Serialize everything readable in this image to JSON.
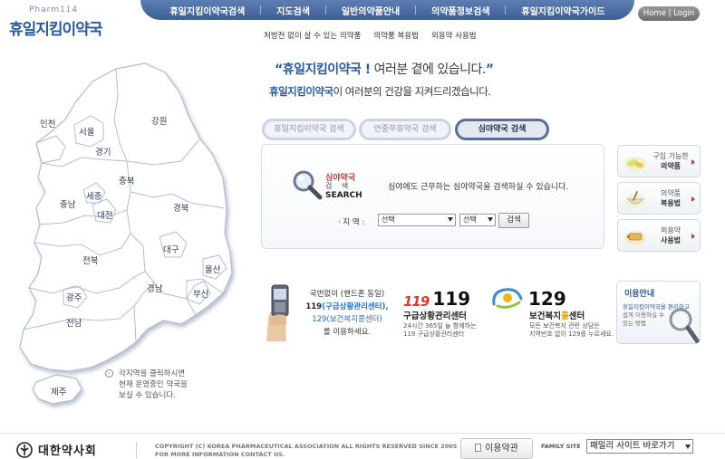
{
  "brand": {
    "sub": "Pharm114",
    "name": "휴일지킴이약국"
  },
  "topnav": {
    "items": [
      {
        "label": "휴일지킴이약국검색"
      },
      {
        "label": "지도검색"
      },
      {
        "label": "일반의약품안내"
      },
      {
        "label": "의약품정보검색"
      },
      {
        "label": "휴일지킴이약국가이드"
      }
    ]
  },
  "home_login": "Home | Login",
  "subnav": {
    "items": [
      {
        "label": "처방전 없이 살 수 있는 의약품"
      },
      {
        "label": "의약품 복용법"
      },
      {
        "label": "외용약 사용법"
      }
    ]
  },
  "slogan": {
    "open_quote": "“",
    "highlight": "휴일지킴이약국 !",
    "rest": " 여러분 곁에 있습니다.",
    "close_quote": "”",
    "line2_highlight": "휴일지킴이약국",
    "line2_rest": "이 여러분의 건강을 지켜드리겠습니다."
  },
  "tabs": [
    {
      "label": "휴일지킴이약국 검색",
      "active": false
    },
    {
      "label": "연중무휴약국 검색",
      "active": false
    },
    {
      "label": "심야약국 검색",
      "active": true
    }
  ],
  "search": {
    "title_ko": "심야약국",
    "title_ko2": "검 색",
    "title_en": "SEARCH",
    "description": "심야에도 근무하는 심야약국을 검색하실 수 있습니다.",
    "region_label": "· 지 역 :",
    "select1_value": "선택",
    "select2_value": "선택",
    "button": "검색"
  },
  "side_buttons": [
    {
      "line1": "구입 가능한",
      "line2": "의약품",
      "icon": "pills-icon"
    },
    {
      "line1": "의약품",
      "line2": "복용법",
      "icon": "mortar-icon"
    },
    {
      "line1": "외용약",
      "line2": "사용법",
      "icon": "ointment-icon"
    }
  ],
  "map": {
    "regions": [
      {
        "name": "인천"
      },
      {
        "name": "서울"
      },
      {
        "name": "경기"
      },
      {
        "name": "강원"
      },
      {
        "name": "충북"
      },
      {
        "name": "충남"
      },
      {
        "name": "세종"
      },
      {
        "name": "대전"
      },
      {
        "name": "경북"
      },
      {
        "name": "대구"
      },
      {
        "name": "전북"
      },
      {
        "name": "울산"
      },
      {
        "name": "경남"
      },
      {
        "name": "부산"
      },
      {
        "name": "광주"
      },
      {
        "name": "전남"
      },
      {
        "name": "제주"
      }
    ],
    "hint_lines": [
      "각지역을 클릭하시면",
      "현재 운영중인 약국을",
      "보실 수 있습니다."
    ]
  },
  "emergency": {
    "phone_line1": "국번없이 (핸드폰 동일)",
    "phone_line2_a": "119",
    "phone_line2_b": "(구급상황관리센터),",
    "phone_line3": "129(보건복지콜센터)",
    "phone_line4": "를 이용하세요.",
    "e119_icon": "119",
    "e119_number": "119",
    "e119_title": "구급상황관리센터",
    "e119_desc1": "24시간 365일 늘 함께하는",
    "e119_desc2": "119 구급상황관리센터",
    "e129_number": "129",
    "e129_title_a": "보건복지",
    "e129_title_hl": "콜",
    "e129_title_b": "센터",
    "e129_desc1": "모든 보건복지 관련 상담은",
    "e129_desc2": "지역번호 없이 129를 누르세요."
  },
  "guide": {
    "title": "이용안내",
    "line1": "휴일지킴이약국을 편리하고",
    "line2": "쉽게 이용하실 수",
    "line3": "있는 방법"
  },
  "footer": {
    "org": "대한약사회",
    "copyright1": "COPYRIGHT (C) KOREA PHARMACEUTICAL ASSOCIATION ALL RIGHTS RESERVED SINCE 2005",
    "copyright2": "FOR MORE INFORMATION CONTACT US.",
    "terms": "이용약관",
    "family_label": "FAMILY SITE",
    "family_value": "패밀리 사이트 바로가기"
  },
  "colors": {
    "brand_blue": "#2b5aa0",
    "nav_bg": "#4a6ca4",
    "accent_red": "#d0342c"
  }
}
